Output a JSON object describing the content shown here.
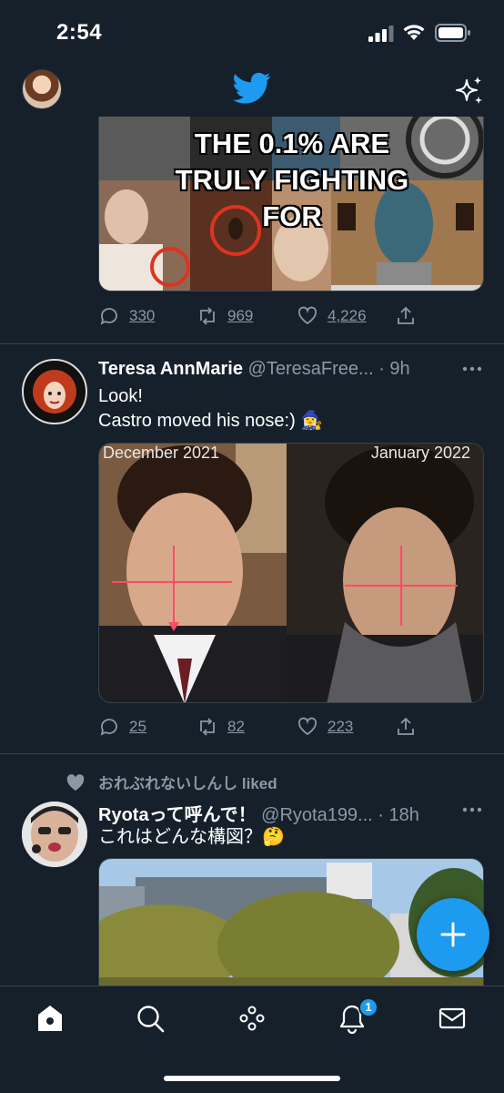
{
  "status_bar": {
    "time": "2:54"
  },
  "nav": {
    "brand_icon": "twitter-bird-icon",
    "timeline_icon": "sparkle-icon"
  },
  "tweets": [
    {
      "media_overlay_text": "THE 0.1% ARE TRULY FIGHTING FOR",
      "replies": "330",
      "retweets": "969",
      "likes": "4,226"
    },
    {
      "name": "Teresa AnnMarie",
      "handle": "@TeresaFree... · 9h",
      "text_line1": "Look!",
      "text_line2": "Castro moved his nose:) 🧙‍♀️",
      "media_label_left": "December 2021",
      "media_label_right": "January 2022",
      "replies": "25",
      "retweets": "82",
      "likes": "223"
    },
    {
      "social_context": "おれぶれないしんし liked",
      "name": "Ryotaって呼んで！",
      "handle": "@Ryota199... · 18h",
      "text_line1": "これはどんな構図？🤔"
    }
  ],
  "tabbar": {
    "notifications_badge": "1"
  },
  "colors": {
    "background": "#15202b",
    "accent": "#1d9bf0",
    "secondary_text": "#8b98a5",
    "divider": "#38444d"
  }
}
